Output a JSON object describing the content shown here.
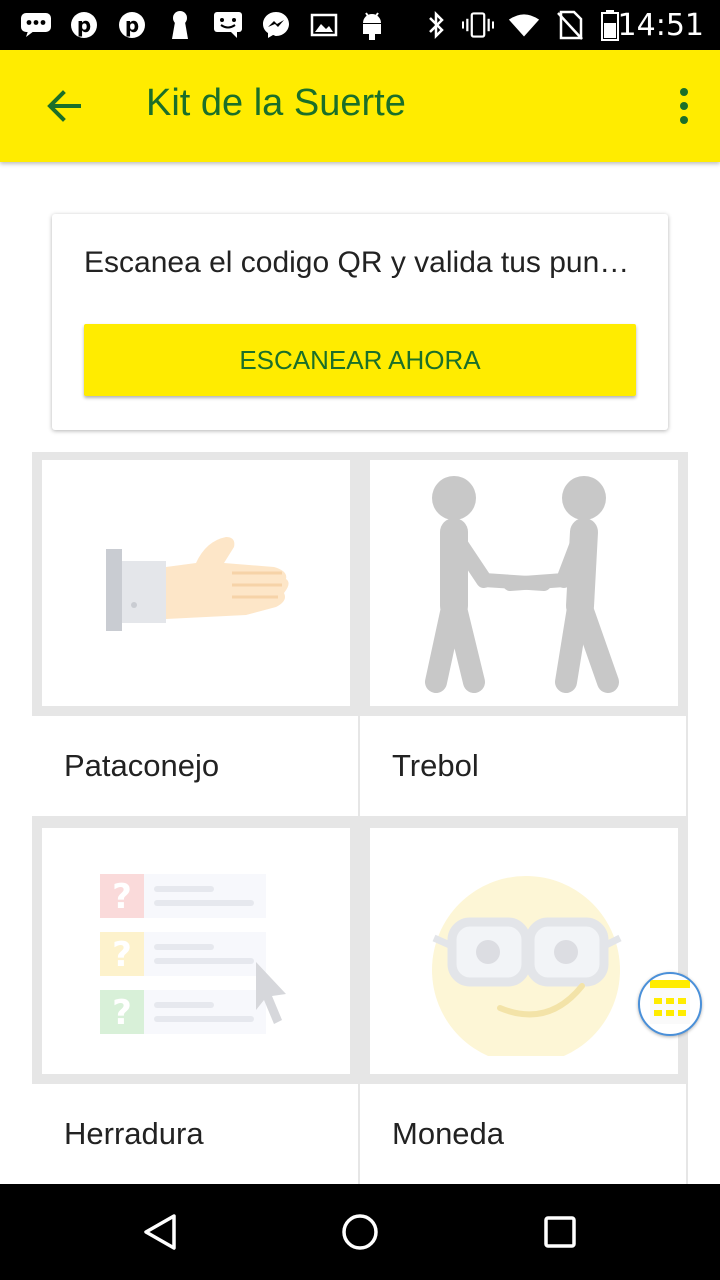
{
  "status_bar": {
    "time": "14:51",
    "icons": [
      "chat-icon",
      "pinterest-icon",
      "pinterest-icon",
      "keyhole-icon",
      "message-icon",
      "messenger-icon",
      "image-icon",
      "android-icon",
      "bluetooth-icon",
      "vibrate-icon",
      "wifi-icon",
      "no-sim-icon",
      "battery-icon"
    ]
  },
  "app_bar": {
    "title": "Kit de la Suerte",
    "color_bg": "#ffec00",
    "color_fg": "#1b6f29"
  },
  "scan_card": {
    "message": "Escanea el codigo QR y valida tus pun…",
    "button_label": "ESCANEAR AHORA"
  },
  "items": [
    {
      "label": "Pataconejo",
      "icon": "handshake-hand-icon"
    },
    {
      "label": "Trebol",
      "icon": "people-handshake-icon"
    },
    {
      "label": "Herradura",
      "icon": "quiz-checklist-icon"
    },
    {
      "label": "Moneda",
      "icon": "smiley-glasses-icon"
    }
  ]
}
